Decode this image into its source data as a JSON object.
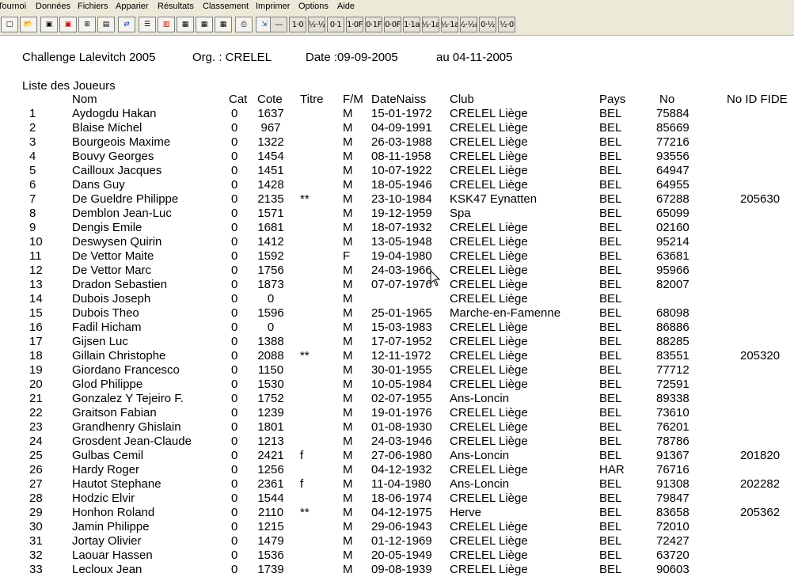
{
  "menu": [
    "Tournoi",
    "Données",
    "Fichiers",
    "Apparier",
    "Résultats",
    "Classement",
    "Imprimer",
    "Options",
    "Aide"
  ],
  "toolbar": {
    "icon_buttons": [
      "new-icon",
      "open-icon",
      "save-icon",
      "save-red-icon",
      "add-window-icon",
      "print-preview-icon",
      "swap-arrows-icon",
      "list-icon",
      "report-red-icon",
      "report-icon",
      "report-icon",
      "report-icon",
      "printer-icon",
      "export-icon"
    ],
    "text_buttons": [
      "---",
      "1·0",
      "½·½",
      "0·1",
      "1·0F",
      "0·1F",
      "0·0F",
      "1·1a",
      "½·1a",
      "½·1a",
      "½·½a",
      "0·½",
      "½·0"
    ]
  },
  "header": {
    "tournament": "Challenge Lalevitch 2005",
    "org": "Org. : CRELEL",
    "date": "Date :09-09-2005",
    "until": "au 04-11-2005"
  },
  "list_title": "Liste des Joueurs",
  "columns": {
    "nom": "Nom",
    "cat": "Cat",
    "cote": "Cote",
    "titre": "Titre",
    "fm": "F/M",
    "datenaiss": "DateNaiss",
    "club": "Club",
    "pays": "Pays",
    "no": "No",
    "fide": "No ID FIDE"
  },
  "players": [
    {
      "n": "1",
      "nom": "Aydogdu Hakan",
      "cat": "0",
      "cote": "1637",
      "titre": "",
      "fm": "M",
      "date": "15-01-1972",
      "club": "CRELEL Liège",
      "pays": "BEL",
      "no": "75884",
      "fide": ""
    },
    {
      "n": "2",
      "nom": "Blaise Michel",
      "cat": "0",
      "cote": "967",
      "titre": "",
      "fm": "M",
      "date": "04-09-1991",
      "club": "CRELEL Liège",
      "pays": "BEL",
      "no": "85669",
      "fide": ""
    },
    {
      "n": "3",
      "nom": "Bourgeois Maxime",
      "cat": "0",
      "cote": "1322",
      "titre": "",
      "fm": "M",
      "date": "26-03-1988",
      "club": "CRELEL Liège",
      "pays": "BEL",
      "no": "77216",
      "fide": ""
    },
    {
      "n": "4",
      "nom": "Bouvy Georges",
      "cat": "0",
      "cote": "1454",
      "titre": "",
      "fm": "M",
      "date": "08-11-1958",
      "club": "CRELEL Liège",
      "pays": "BEL",
      "no": "93556",
      "fide": ""
    },
    {
      "n": "5",
      "nom": "Cailloux Jacques",
      "cat": "0",
      "cote": "1451",
      "titre": "",
      "fm": "M",
      "date": "10-07-1922",
      "club": "CRELEL Liège",
      "pays": "BEL",
      "no": "64947",
      "fide": ""
    },
    {
      "n": "6",
      "nom": "Dans Guy",
      "cat": "0",
      "cote": "1428",
      "titre": "",
      "fm": "M",
      "date": "18-05-1946",
      "club": "CRELEL Liège",
      "pays": "BEL",
      "no": "64955",
      "fide": ""
    },
    {
      "n": "7",
      "nom": "De Gueldre Philippe",
      "cat": "0",
      "cote": "2135",
      "titre": "**",
      "fm": "M",
      "date": "23-10-1984",
      "club": "KSK47 Eynatten",
      "pays": "BEL",
      "no": "67288",
      "fide": "205630"
    },
    {
      "n": "8",
      "nom": "Demblon Jean-Luc",
      "cat": "0",
      "cote": "1571",
      "titre": "",
      "fm": "M",
      "date": "19-12-1959",
      "club": "Spa",
      "pays": "BEL",
      "no": "65099",
      "fide": ""
    },
    {
      "n": "9",
      "nom": "Dengis Emile",
      "cat": "0",
      "cote": "1681",
      "titre": "",
      "fm": "M",
      "date": "18-07-1932",
      "club": "CRELEL Liège",
      "pays": "BEL",
      "no": "02160",
      "fide": ""
    },
    {
      "n": "10",
      "nom": "Deswysen Quirin",
      "cat": "0",
      "cote": "1412",
      "titre": "",
      "fm": "M",
      "date": "13-05-1948",
      "club": "CRELEL Liège",
      "pays": "BEL",
      "no": "95214",
      "fide": ""
    },
    {
      "n": "11",
      "nom": "De Vettor Maite",
      "cat": "0",
      "cote": "1592",
      "titre": "",
      "fm": "F",
      "date": "19-04-1980",
      "club": "CRELEL Liège",
      "pays": "BEL",
      "no": "63681",
      "fide": ""
    },
    {
      "n": "12",
      "nom": "De Vettor Marc",
      "cat": "0",
      "cote": "1756",
      "titre": "",
      "fm": "M",
      "date": "24-03-1966",
      "club": "CRELEL Liège",
      "pays": "BEL",
      "no": "95966",
      "fide": ""
    },
    {
      "n": "13",
      "nom": "Dradon Sebastien",
      "cat": "0",
      "cote": "1873",
      "titre": "",
      "fm": "M",
      "date": "07-07-1976",
      "club": "CRELEL Liège",
      "pays": "BEL",
      "no": "82007",
      "fide": ""
    },
    {
      "n": "14",
      "nom": "Dubois Joseph",
      "cat": "0",
      "cote": "0",
      "titre": "",
      "fm": "M",
      "date": "",
      "club": "CRELEL Liège",
      "pays": "BEL",
      "no": "",
      "fide": ""
    },
    {
      "n": "15",
      "nom": "Dubois Theo",
      "cat": "0",
      "cote": "1596",
      "titre": "",
      "fm": "M",
      "date": "25-01-1965",
      "club": "Marche-en-Famenne",
      "pays": "BEL",
      "no": "68098",
      "fide": ""
    },
    {
      "n": "16",
      "nom": "Fadil Hicham",
      "cat": "0",
      "cote": "0",
      "titre": "",
      "fm": "M",
      "date": "15-03-1983",
      "club": "CRELEL Liège",
      "pays": "BEL",
      "no": "86886",
      "fide": ""
    },
    {
      "n": "17",
      "nom": "Gijsen Luc",
      "cat": "0",
      "cote": "1388",
      "titre": "",
      "fm": "M",
      "date": "17-07-1952",
      "club": "CRELEL Liège",
      "pays": "BEL",
      "no": "88285",
      "fide": ""
    },
    {
      "n": "18",
      "nom": "Gillain Christophe",
      "cat": "0",
      "cote": "2088",
      "titre": "**",
      "fm": "M",
      "date": "12-11-1972",
      "club": "CRELEL Liège",
      "pays": "BEL",
      "no": "83551",
      "fide": "205320"
    },
    {
      "n": "19",
      "nom": "Giordano Francesco",
      "cat": "0",
      "cote": "1150",
      "titre": "",
      "fm": "M",
      "date": "30-01-1955",
      "club": "CRELEL Liège",
      "pays": "BEL",
      "no": "77712",
      "fide": ""
    },
    {
      "n": "20",
      "nom": "Glod Philippe",
      "cat": "0",
      "cote": "1530",
      "titre": "",
      "fm": "M",
      "date": "10-05-1984",
      "club": "CRELEL Liège",
      "pays": "BEL",
      "no": "72591",
      "fide": ""
    },
    {
      "n": "21",
      "nom": "Gonzalez Y Tejeiro F.",
      "cat": "0",
      "cote": "1752",
      "titre": "",
      "fm": "M",
      "date": "02-07-1955",
      "club": "Ans-Loncin",
      "pays": "BEL",
      "no": "89338",
      "fide": ""
    },
    {
      "n": "22",
      "nom": "Graitson Fabian",
      "cat": "0",
      "cote": "1239",
      "titre": "",
      "fm": "M",
      "date": "19-01-1976",
      "club": "CRELEL Liège",
      "pays": "BEL",
      "no": "73610",
      "fide": ""
    },
    {
      "n": "23",
      "nom": "Grandhenry Ghislain",
      "cat": "0",
      "cote": "1801",
      "titre": "",
      "fm": "M",
      "date": "01-08-1930",
      "club": "CRELEL Liège",
      "pays": "BEL",
      "no": "76201",
      "fide": ""
    },
    {
      "n": "24",
      "nom": "Grosdent Jean-Claude",
      "cat": "0",
      "cote": "1213",
      "titre": "",
      "fm": "M",
      "date": "24-03-1946",
      "club": "CRELEL Liège",
      "pays": "BEL",
      "no": "78786",
      "fide": ""
    },
    {
      "n": "25",
      "nom": "Gulbas Cemil",
      "cat": "0",
      "cote": "2421",
      "titre": "f",
      "fm": "M",
      "date": "27-06-1980",
      "club": "Ans-Loncin",
      "pays": "BEL",
      "no": "91367",
      "fide": "201820"
    },
    {
      "n": "26",
      "nom": "Hardy Roger",
      "cat": "0",
      "cote": "1256",
      "titre": "",
      "fm": "M",
      "date": "04-12-1932",
      "club": "CRELEL Liège",
      "pays": "HAR",
      "no": "76716",
      "fide": ""
    },
    {
      "n": "27",
      "nom": "Hautot Stephane",
      "cat": "0",
      "cote": "2361",
      "titre": "f",
      "fm": "M",
      "date": "11-04-1980",
      "club": "Ans-Loncin",
      "pays": "BEL",
      "no": "91308",
      "fide": "202282"
    },
    {
      "n": "28",
      "nom": "Hodzic Elvir",
      "cat": "0",
      "cote": "1544",
      "titre": "",
      "fm": "M",
      "date": "18-06-1974",
      "club": "CRELEL Liège",
      "pays": "BEL",
      "no": "79847",
      "fide": ""
    },
    {
      "n": "29",
      "nom": "Honhon Roland",
      "cat": "0",
      "cote": "2110",
      "titre": "**",
      "fm": "M",
      "date": "04-12-1975",
      "club": "Herve",
      "pays": "BEL",
      "no": "83658",
      "fide": "205362"
    },
    {
      "n": "30",
      "nom": "Jamin Philippe",
      "cat": "0",
      "cote": "1215",
      "titre": "",
      "fm": "M",
      "date": "29-06-1943",
      "club": "CRELEL Liège",
      "pays": "BEL",
      "no": "72010",
      "fide": ""
    },
    {
      "n": "31",
      "nom": "Jortay Olivier",
      "cat": "0",
      "cote": "1479",
      "titre": "",
      "fm": "M",
      "date": "01-12-1969",
      "club": "CRELEL Liège",
      "pays": "BEL",
      "no": "72427",
      "fide": ""
    },
    {
      "n": "32",
      "nom": "Laouar Hassen",
      "cat": "0",
      "cote": "1536",
      "titre": "",
      "fm": "M",
      "date": "20-05-1949",
      "club": "CRELEL Liège",
      "pays": "BEL",
      "no": "63720",
      "fide": ""
    },
    {
      "n": "33",
      "nom": "Lecloux Jean",
      "cat": "0",
      "cote": "1739",
      "titre": "",
      "fm": "M",
      "date": "09-08-1939",
      "club": "CRELEL Liège",
      "pays": "BEL",
      "no": "90603",
      "fide": ""
    }
  ]
}
